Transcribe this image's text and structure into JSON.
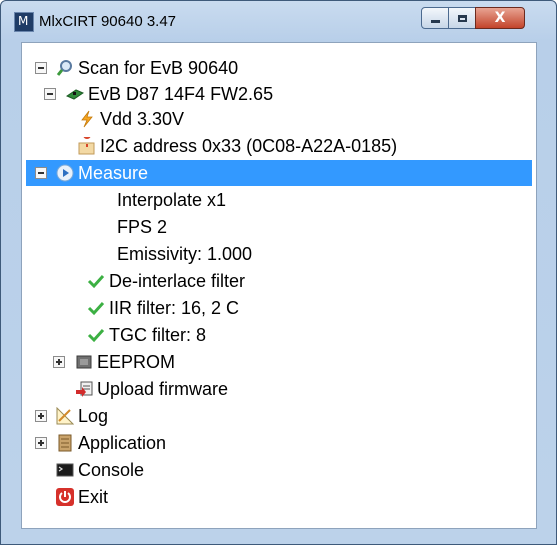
{
  "window": {
    "title": "MlxCIRT 90640 3.47",
    "app_icon_glyph": "M"
  },
  "caption_buttons": {
    "minimize_icon": "minimize-icon",
    "maximize_icon": "maximize-icon",
    "close_icon": "close-icon",
    "close_glyph": "X"
  },
  "colors": {
    "selection": "#3399ff",
    "titlebar": "#bcd2ea",
    "check": "#3cb043"
  },
  "tree": {
    "items": [
      {
        "label": "Scan for EvB 90640",
        "icon": "search-icon",
        "expander": "minus"
      },
      {
        "label": "EvB D87 14F4 FW2.65",
        "icon": "board-icon",
        "expander": "minus"
      },
      {
        "label": "Vdd 3.30V",
        "icon": "lightning-icon"
      },
      {
        "label": "I2C address 0x33 (0C08-A22A-0185)",
        "icon": "address-icon"
      },
      {
        "label": "Measure",
        "icon": "play-icon",
        "expander": "minus",
        "selected": true
      },
      {
        "label": "Interpolate x1"
      },
      {
        "label": "FPS 2"
      },
      {
        "label": "Emissivity: 1.000"
      },
      {
        "label": "De-interlace filter",
        "icon": "check-icon"
      },
      {
        "label": "IIR filter: 16, 2 C",
        "icon": "check-icon"
      },
      {
        "label": "TGC filter: 8",
        "icon": "check-icon"
      },
      {
        "label": "EEPROM",
        "icon": "chip-icon",
        "expander": "plus"
      },
      {
        "label": "Upload firmware",
        "icon": "upload-firmware-icon"
      },
      {
        "label": "Log",
        "icon": "log-icon",
        "expander": "plus"
      },
      {
        "label": "Application",
        "icon": "application-icon",
        "expander": "plus"
      },
      {
        "label": "Console",
        "icon": "console-icon"
      },
      {
        "label": "Exit",
        "icon": "power-icon"
      }
    ]
  }
}
